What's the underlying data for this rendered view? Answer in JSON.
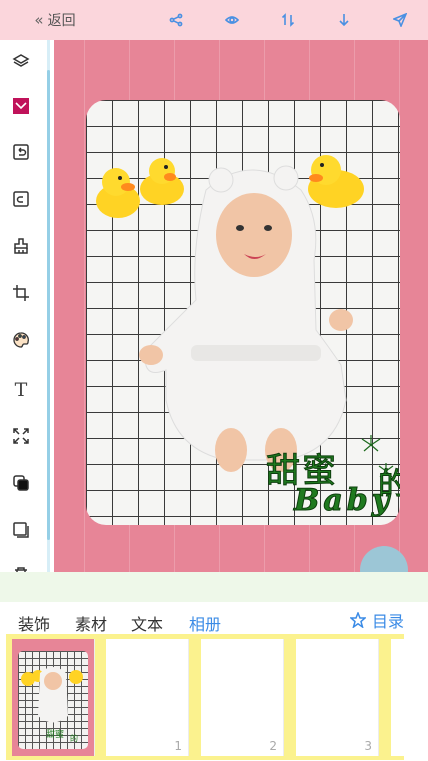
{
  "topbar": {
    "back_label": "返回",
    "back_icon": "double-chevron-left-icon",
    "tools": [
      "share-icon",
      "eye-icon",
      "swap-vertical-icon",
      "arrow-down-icon",
      "send-icon"
    ]
  },
  "left_toolbar": {
    "items": [
      "layers-icon",
      "background-icon",
      "undo-icon",
      "redo-icon",
      "brush-icon",
      "crop-icon",
      "palette-icon",
      "T",
      "expand-icon",
      "copy-icon",
      "duplicate-icon"
    ]
  },
  "canvas": {
    "background_color": "#e78597",
    "sticker_line1": "甜蜜",
    "sticker_line2": "的",
    "sticker_line3": "Baby"
  },
  "tabs": [
    "装饰",
    "素材",
    "文本",
    "相册"
  ],
  "active_tab": "相册",
  "catalog_label": "目录",
  "pages": [
    {
      "number": ""
    },
    {
      "number": "1"
    },
    {
      "number": "2"
    },
    {
      "number": "3"
    }
  ],
  "colors": {
    "accent": "#3b8be6",
    "topbar": "#fbd6dc",
    "pages_strip": "#fbf28e",
    "fab": "#9cc6d6"
  }
}
